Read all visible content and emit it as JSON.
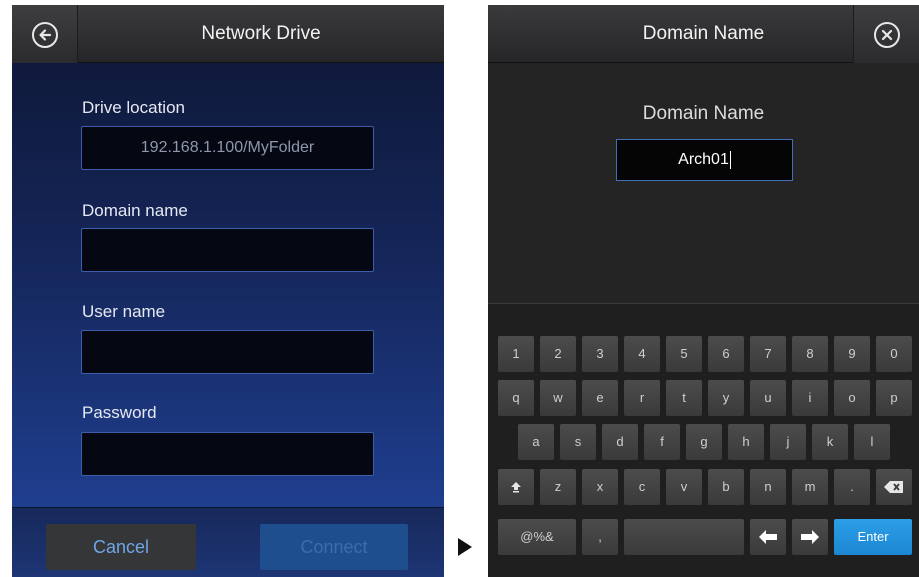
{
  "left_screen": {
    "title": "Network Drive",
    "fields": [
      {
        "label": "Drive location",
        "value": "192.168.1.100/MyFolder"
      },
      {
        "label": "Domain name",
        "value": ""
      },
      {
        "label": "User name",
        "value": ""
      },
      {
        "label": "Password",
        "value": ""
      }
    ],
    "cancel_label": "Cancel",
    "connect_label": "Connect",
    "icons": {
      "back": "back-arrow-icon"
    }
  },
  "right_screen": {
    "title": "Domain Name",
    "prompt_label": "Domain Name",
    "input_value": "Arch01",
    "icons": {
      "close": "close-icon"
    },
    "keyboard": {
      "row1": [
        "1",
        "2",
        "3",
        "4",
        "5",
        "6",
        "7",
        "8",
        "9",
        "0"
      ],
      "row2": [
        "q",
        "w",
        "e",
        "r",
        "t",
        "y",
        "u",
        "i",
        "o",
        "p"
      ],
      "row3": [
        "a",
        "s",
        "d",
        "f",
        "g",
        "h",
        "j",
        "k",
        "l"
      ],
      "row4": [
        "z",
        "x",
        "c",
        "v",
        "b",
        "n",
        "m",
        "."
      ],
      "symbols_label": "@%&",
      "comma_label": ",",
      "enter_label": "Enter"
    }
  },
  "colors": {
    "accent_blue": "#1c86d2",
    "cancel_text": "#6fa6e6",
    "left_bg": "#1d3a86",
    "right_bg": "#242424"
  }
}
